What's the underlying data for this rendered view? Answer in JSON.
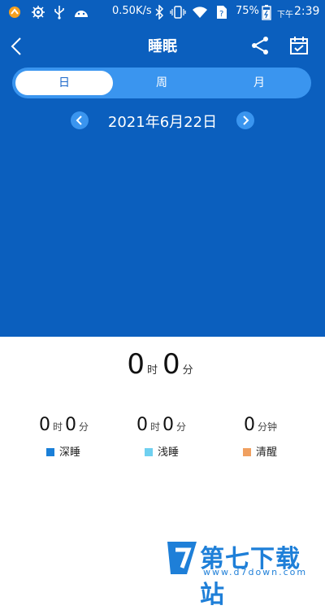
{
  "status_bar": {
    "network_speed": "0.50K/s",
    "battery": "75%",
    "time_prefix": "下午",
    "time": "2:39"
  },
  "header": {
    "title": "睡眠"
  },
  "tabs": [
    {
      "label": "日",
      "active": true
    },
    {
      "label": "周",
      "active": false
    },
    {
      "label": "月",
      "active": false
    }
  ],
  "date": "2021年6月22日",
  "summary": {
    "hours": "0",
    "hours_unit": "时",
    "minutes": "0",
    "minutes_unit": "分"
  },
  "stats": [
    {
      "hours": "0",
      "hours_unit": "时",
      "minutes": "0",
      "minutes_unit": "分",
      "label": "深睡",
      "color": "#1a7fd8"
    },
    {
      "hours": "0",
      "hours_unit": "时",
      "minutes": "0",
      "minutes_unit": "分",
      "label": "浅睡",
      "color": "#6fd0f0"
    },
    {
      "value": "0",
      "unit": "分钟",
      "label": "清醒",
      "color": "#f0a060"
    }
  ],
  "watermark": {
    "name": "第七下载站",
    "url": "www.d7down.com"
  },
  "colors": {
    "header_bg": "#0b5fbe",
    "tab_bar": "#3a95ef"
  }
}
